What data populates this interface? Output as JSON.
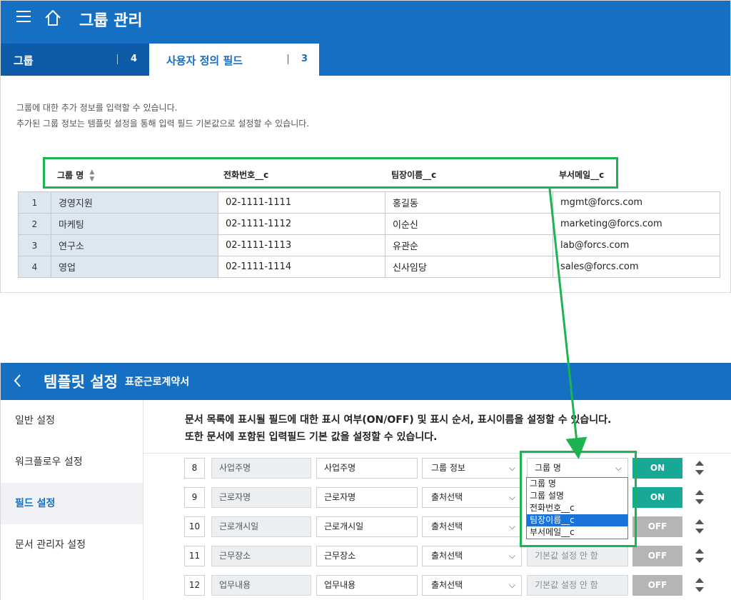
{
  "top": {
    "page_title": "그룹 관리",
    "tabs": [
      {
        "label": "그룹",
        "count": "4"
      },
      {
        "label": "사용자 정의 필드",
        "count": "3"
      }
    ],
    "description": [
      "그룹에 대한 추가 정보를 입력할 수 있습니다.",
      "추가된 그룹 정보는 템플릿 설정을 통해 입력 필드 기본값으로 설정할 수 있습니다."
    ],
    "table": {
      "headers": [
        "그룹 명",
        "전화번호__c",
        "팀장이름__c",
        "부서메일__c"
      ],
      "rows": [
        [
          "1",
          "경영지원",
          "02-1111-1111",
          "홍길동",
          "mgmt@forcs.com"
        ],
        [
          "2",
          "마케팅",
          "02-1111-1112",
          "이순신",
          "marketing@forcs.com"
        ],
        [
          "3",
          "연구소",
          "02-1111-1113",
          "유관순",
          "lab@forcs.com"
        ],
        [
          "4",
          "영업",
          "02-1111-1114",
          "신사임당",
          "sales@forcs.com"
        ]
      ]
    }
  },
  "bottom": {
    "title": "템플릿 설정",
    "subtitle": "표준근로계약서",
    "sidebar": [
      "일반 설정",
      "워크플로우 설정",
      "필드 설정",
      "문서 관리자 설정"
    ],
    "active_sidebar": "필드 설정",
    "description": [
      "문서 목록에 표시될 필드에 대한 표시 여부(ON/OFF) 및 표시 순서, 표시이름을 설정할 수 있습니다.",
      "또한 문서에 포함된 입력필드 기본 값을 설정할 수 있습니다."
    ],
    "rows": [
      {
        "num": "8",
        "original": "사업주명",
        "display": "사업주명",
        "source": "그룹 정보",
        "default": "그룹 명",
        "toggle": "ON"
      },
      {
        "num": "9",
        "original": "근로자명",
        "display": "근로자명",
        "source": "출처선택",
        "default": "",
        "toggle": "ON"
      },
      {
        "num": "10",
        "original": "근로개시일",
        "display": "근로개시일",
        "source": "출처선택",
        "default": "",
        "toggle": "OFF"
      },
      {
        "num": "11",
        "original": "근무장소",
        "display": "근무장소",
        "source": "출처선택",
        "default": "기본값 설정 안 함",
        "toggle": "OFF"
      },
      {
        "num": "12",
        "original": "업무내용",
        "display": "업무내용",
        "source": "출처선택",
        "default": "기본값 설정 안 함",
        "toggle": "OFF"
      }
    ],
    "dropdown_options": [
      "그룹 명",
      "그룹 설명",
      "전화번호__c",
      "팀장이름__c",
      "부서메일__c"
    ],
    "dropdown_selected": "팀장이름__c"
  },
  "colors": {
    "header_blue": "#1570c4",
    "highlight_green": "#1db351",
    "toggle_on": "#18a896",
    "toggle_off": "#b5b5b5"
  }
}
